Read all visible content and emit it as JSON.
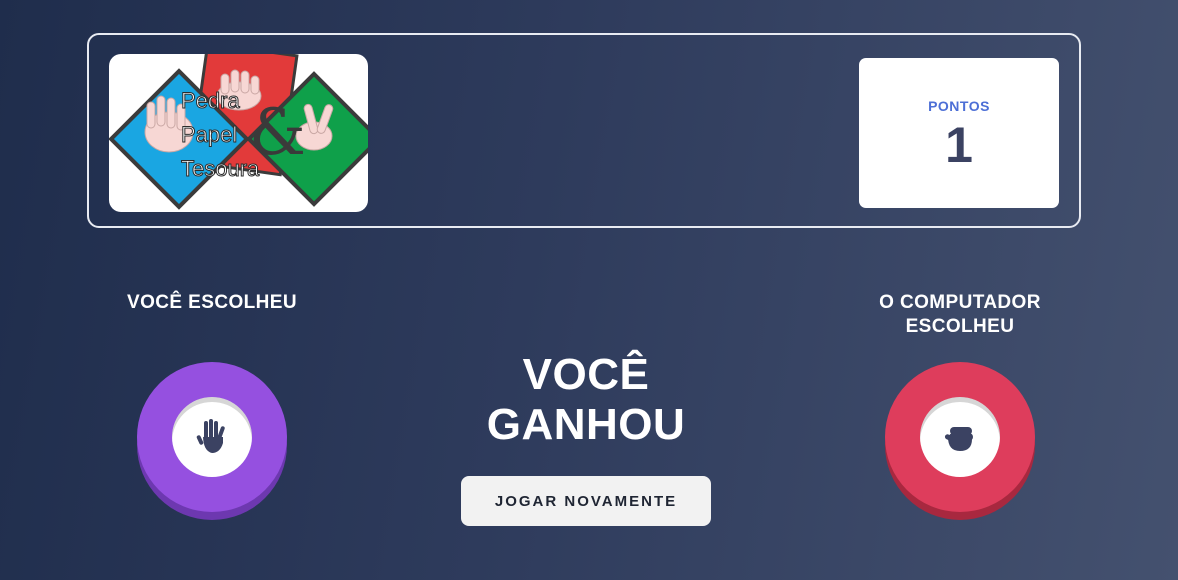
{
  "header": {
    "logo": {
      "words": [
        "Pedra",
        "Papel",
        "Tesoura"
      ],
      "ampersand": "&"
    },
    "score": {
      "label": "PONTOS",
      "value": "1"
    }
  },
  "player": {
    "title": "VOCÊ ESCOLHEU",
    "choice_icon": "hand-icon",
    "chip_color": "#9550e0"
  },
  "computer": {
    "title_line1": "O COMPUTADOR",
    "title_line2": "ESCOLHEU",
    "choice_icon": "fist-icon",
    "chip_color": "#de3d5c"
  },
  "result": {
    "line1": "VOCÊ",
    "line2": "GANHOU",
    "button_label": "JOGAR NOVAMENTE"
  },
  "colors": {
    "score_label": "#4d6fd6",
    "score_value": "#3b4262",
    "icon": "#3b4262"
  }
}
